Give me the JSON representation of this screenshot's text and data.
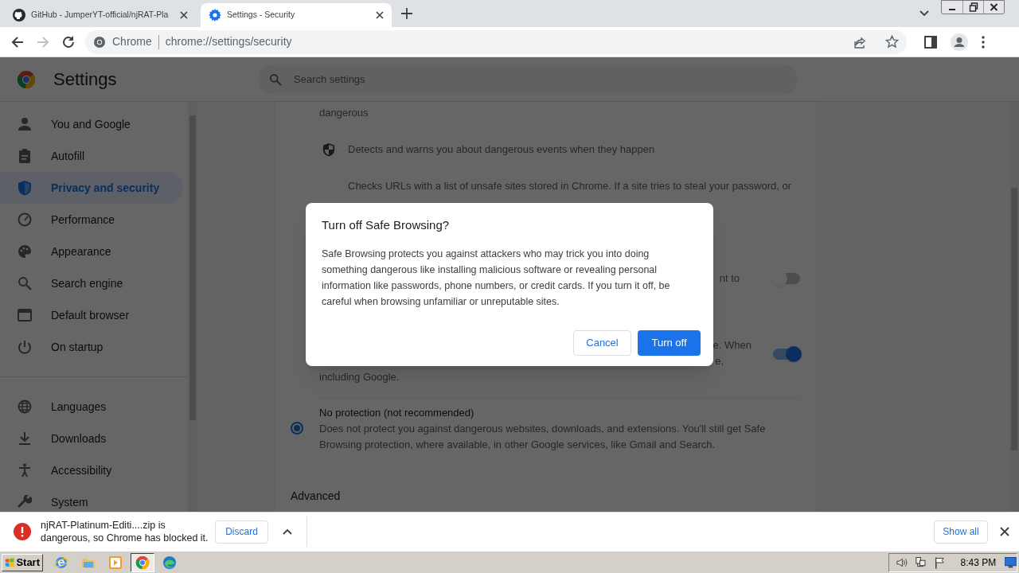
{
  "tabs": [
    {
      "kind": "github",
      "title": "GitHub - JumperYT-official/njRAT-Pla",
      "selected": false
    },
    {
      "kind": "settings",
      "title": "Settings - Security",
      "selected": true
    }
  ],
  "toolbar": {
    "forward_disabled": true,
    "origin": "Chrome",
    "url": "chrome://settings/security"
  },
  "header": {
    "title": "Settings",
    "search_placeholder": "Search settings"
  },
  "sidebar": {
    "groups": [
      [
        {
          "label": "You and Google",
          "selected": false
        },
        {
          "label": "Autofill",
          "selected": false
        },
        {
          "label": "Privacy and security",
          "selected": true
        },
        {
          "label": "Performance",
          "selected": false
        },
        {
          "label": "Appearance",
          "selected": false
        },
        {
          "label": "Search engine",
          "selected": false
        },
        {
          "label": "Default browser",
          "selected": false
        },
        {
          "label": "On startup",
          "selected": false
        }
      ],
      [
        {
          "label": "Languages",
          "selected": false
        },
        {
          "label": "Downloads",
          "selected": false
        },
        {
          "label": "Accessibility",
          "selected": false
        },
        {
          "label": "System",
          "selected": false
        }
      ]
    ]
  },
  "content": [
    {
      "kind": "text",
      "text": "dangerous"
    },
    {
      "kind": "feature",
      "text": "Detects and warns you about dangerous events when they happen"
    },
    {
      "kind": "feature-detail",
      "text": "Checks URLs with a list of unsafe sites stored in Chrome. If a site tries to steal your password, or"
    },
    {
      "kind": "toggle",
      "lines": [
        "nt to"
      ],
      "on": false
    },
    {
      "kind": "toggle",
      "lines": [
        "e. When",
        "e,",
        "including Google."
      ],
      "on": true
    },
    {
      "kind": "radio",
      "title": "No protection (not recommended)",
      "text": "Does not protect you against dangerous websites, downloads, and extensions. You'll still get Safe Browsing protection, where available, in other Google services, like Gmail and Search.",
      "selected": true
    },
    {
      "kind": "heading",
      "text": "Advanced"
    }
  ],
  "dialog": {
    "title": "Turn off Safe Browsing?",
    "body": "Safe Browsing protects you against attackers who may trick you into doing something dangerous like installing malicious software or revealing personal information like passwords, phone numbers, or credit cards. If you turn it off, be careful when browsing unfamiliar or unreputable sites.",
    "buttons": [
      {
        "kind": "secondary",
        "label": "Cancel"
      },
      {
        "kind": "primary",
        "label": "Turn off"
      }
    ]
  },
  "download_shelf": {
    "message": "njRAT-Platinum-Editi....zip is dangerous, so Chrome has blocked it.",
    "discard": "Discard",
    "show_all": "Show all"
  },
  "taskbar": {
    "start": "Start",
    "apps": [
      {
        "kind": "ie",
        "selected": false
      },
      {
        "kind": "folder",
        "selected": false
      },
      {
        "kind": "media",
        "selected": false
      },
      {
        "kind": "chrome",
        "selected": true
      },
      {
        "kind": "edge",
        "selected": false
      }
    ],
    "clock": "8:43 PM"
  }
}
